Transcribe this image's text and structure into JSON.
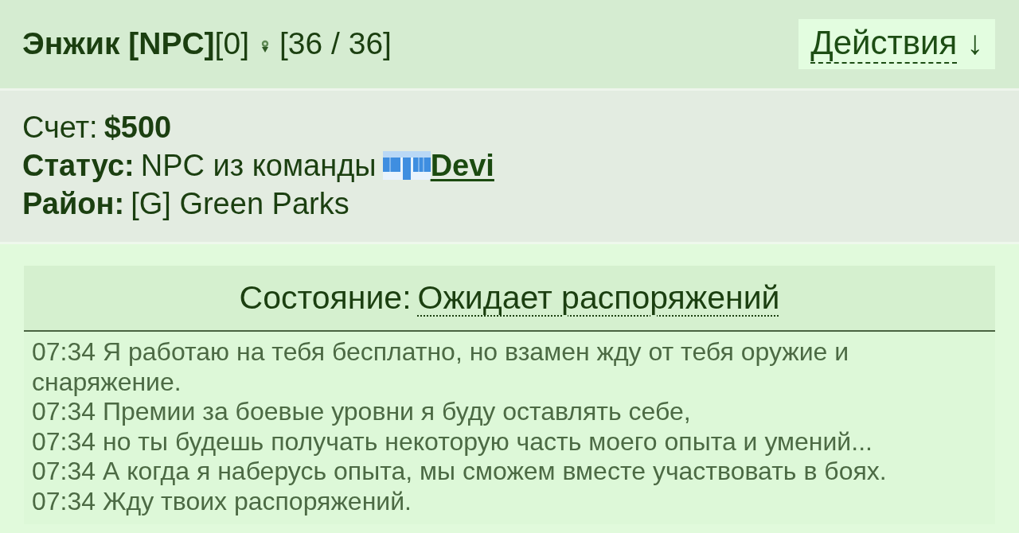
{
  "header": {
    "name": "Энжик [NPC]",
    "level": "[0]",
    "health": "[36 / 36]",
    "actions": {
      "label": "Действия",
      "arrow": "↓"
    }
  },
  "info": {
    "account": {
      "label": "Счет:",
      "value": "$500"
    },
    "status": {
      "label": "Статус:",
      "text": "NPC из команды",
      "team": "Devi"
    },
    "district": {
      "label": "Район:",
      "value": "[G] Green Parks"
    }
  },
  "state": {
    "label": "Состояние:",
    "value": "Ожидает распоряжений"
  },
  "log": [
    "07:34 Я работаю на тебя бесплатно, но взамен жду от тебя оружие и снаряжение.",
    "07:34 Премии за боевые уровни я буду оставлять себе,",
    "07:34 но ты будешь получать некоторую часть моего опыта и умений...",
    "07:34 А когда я наберусь опыта, мы сможем вместе участвовать в боях.",
    "07:34 Жду твоих распоряжений."
  ]
}
